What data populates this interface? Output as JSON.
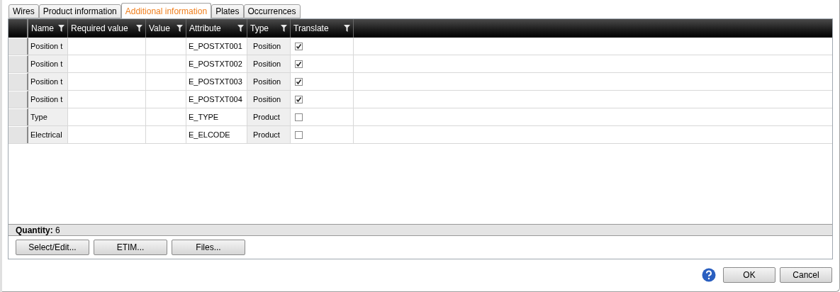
{
  "tabs": [
    {
      "label": "Wires",
      "selected": false
    },
    {
      "label": "Product information",
      "selected": false
    },
    {
      "label": "Additional information",
      "selected": true
    },
    {
      "label": "Plates",
      "selected": false
    },
    {
      "label": "Occurrences",
      "selected": false
    }
  ],
  "table": {
    "columns": [
      "Name",
      "Required value",
      "Value",
      "Attribute",
      "Type",
      "Translate"
    ],
    "rows": [
      {
        "name": "Position t",
        "attribute": "E_POSTXT001",
        "type": "Position",
        "translate": true
      },
      {
        "name": "Position t",
        "attribute": "E_POSTXT002",
        "type": "Position",
        "translate": true
      },
      {
        "name": "Position t",
        "attribute": "E_POSTXT003",
        "type": "Position",
        "translate": true
      },
      {
        "name": "Position t",
        "attribute": "E_POSTXT004",
        "type": "Position",
        "translate": true
      },
      {
        "name": "Type",
        "attribute": "E_TYPE",
        "type": "Product",
        "translate": false
      },
      {
        "name": "Electrical",
        "attribute": "E_ELCODE",
        "type": "Product",
        "translate": false
      }
    ]
  },
  "status": "**Quantity:** 6",
  "panel_buttons": [
    "Select/Edit...",
    "ETIM...",
    "Files..."
  ],
  "dialog_buttons": [
    "OK",
    "Cancel"
  ]
}
